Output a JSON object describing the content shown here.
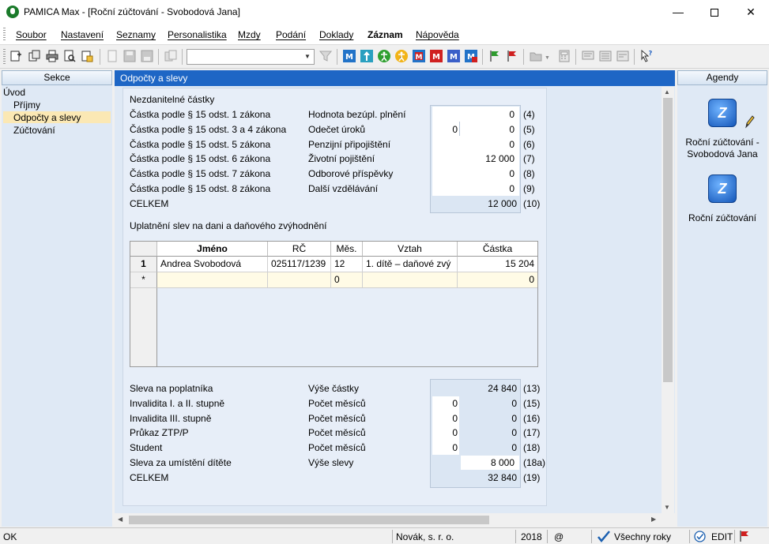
{
  "window": {
    "title": "PAMICA Max - [Roční zúčtování - Svobodová Jana]",
    "icons": {
      "minimize": "minimize-icon",
      "maximize": "maximize-icon",
      "close": "close-icon"
    }
  },
  "menu": {
    "items": [
      "Soubor",
      "Nastavení",
      "Seznamy",
      "Personalistika",
      "Mzdy",
      "Podání",
      "Doklady",
      "Záznam",
      "Nápověda"
    ]
  },
  "toolbar": {
    "combo_value": "",
    "icons": [
      "new-record-icon",
      "copy-icon",
      "print-icon",
      "print-preview-icon",
      "export-icon",
      "blank-page-icon",
      "save-icon",
      "save-disk-icon",
      "duplicate-icon",
      "filter-icon",
      "m-icon",
      "person-up-icon",
      "accessibility-icon",
      "accessibility-alt-icon",
      "m-red-icon",
      "m-red-alt-icon",
      "m-blue-icon",
      "m-mail-icon",
      "green-flag-icon",
      "red-flag-icon",
      "folder-icon",
      "calculator-icon",
      "comment-icon",
      "list-icon",
      "note-icon",
      "help-pointer-icon"
    ]
  },
  "sections": {
    "header": "Sekce",
    "items": [
      "Úvod",
      "Příjmy",
      "Odpočty a slevy",
      "Zúčtování"
    ],
    "selected": "Odpočty a slevy"
  },
  "main": {
    "header": "Odpočty a slevy",
    "nontaxable": {
      "title": "Nezdanitelné částky",
      "left_labels": [
        "Částka podle § 15 odst. 1 zákona",
        "Částka podle § 15 odst. 3 a 4 zákona",
        "Částka podle § 15 odst. 5 zákona",
        "Částka podle § 15 odst. 6 zákona",
        "Částka podle § 15 odst. 7 zákona",
        "Částka podle § 15 odst. 8 zákona",
        "CELKEM"
      ],
      "rows": [
        {
          "label": "Hodnota bezúpl. plnění",
          "count": "",
          "value": "0",
          "ref": "(4)"
        },
        {
          "label": "Odečet úroků",
          "count": "0",
          "value": "0",
          "ref": "(5)"
        },
        {
          "label": "Penzijní připojištění",
          "count": "",
          "value": "0",
          "ref": "(6)"
        },
        {
          "label": "Životní pojištění",
          "count": "",
          "value": "12 000",
          "ref": "(7)"
        },
        {
          "label": "Odborové příspěvky",
          "count": "",
          "value": "0",
          "ref": "(8)"
        },
        {
          "label": "Další vzdělávání",
          "count": "",
          "value": "0",
          "ref": "(9)"
        }
      ],
      "total": {
        "value": "12 000",
        "ref": "(10)"
      }
    },
    "children": {
      "title": "Uplatnění slev na dani a daňového zvýhodnění",
      "columns": [
        "Jméno",
        "RČ",
        "Měs.",
        "Vztah",
        "Částka"
      ],
      "rows": [
        {
          "row": "1",
          "name": "Andrea Svobodová",
          "rc": "025117/1239",
          "months": "12",
          "relation": "1. dítě – daňové zvý",
          "amount": "15 204"
        },
        {
          "row": "*",
          "name": "",
          "rc": "",
          "months": "0",
          "relation": "",
          "amount": "0"
        }
      ]
    },
    "credits": {
      "left_labels": [
        "Sleva na poplatníka",
        "Invalidita I. a II. stupně",
        "Invalidita III. stupně",
        "Průkaz ZTP/P",
        "Student",
        "Sleva za umístění dítěte",
        "CELKEM"
      ],
      "rows": [
        {
          "label": "Výše částky",
          "count": "",
          "value": "24 840",
          "ref": "(13)"
        },
        {
          "label": "Počet měsíců",
          "count": "0",
          "value": "0",
          "ref": "(15)"
        },
        {
          "label": "Počet měsíců",
          "count": "0",
          "value": "0",
          "ref": "(16)"
        },
        {
          "label": "Počet měsíců",
          "count": "0",
          "value": "0",
          "ref": "(17)"
        },
        {
          "label": "Počet měsíců",
          "count": "0",
          "value": "0",
          "ref": "(18)"
        },
        {
          "label": "Výše slevy",
          "count": "",
          "value": "8 000",
          "ref": "(18a)"
        }
      ],
      "total": {
        "value": "32 840",
        "ref": "(19)"
      }
    }
  },
  "agendas": {
    "header": "Agendy",
    "items": [
      {
        "line1": "Roční zúčtování -",
        "line2": "Svobodová Jana",
        "icon": "agenda-z-icon",
        "badge": "pencil-icon"
      },
      {
        "line1": "Roční zúčtování",
        "line2": "",
        "icon": "agenda-z-icon"
      }
    ]
  },
  "status": {
    "left": "OK",
    "company": "Novák, s. r. o.",
    "year": "2018",
    "at": "@",
    "years": "Všechny roky",
    "mode": "EDIT"
  }
}
